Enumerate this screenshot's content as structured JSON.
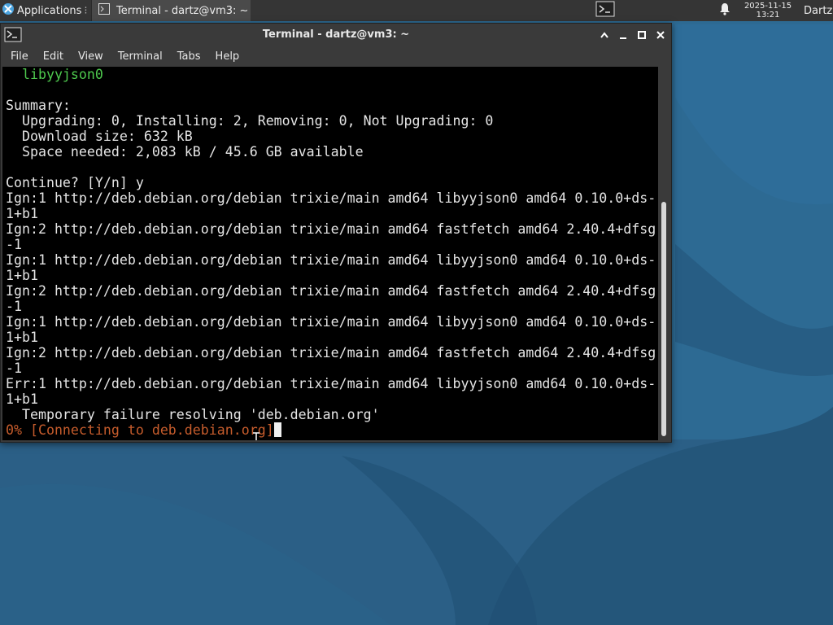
{
  "panel": {
    "applications_label": "Applications",
    "task_label": "Terminal - dartz@vm3: ~",
    "clock_date": "2025-11-15",
    "clock_time": "13:21",
    "user": "Dartz"
  },
  "window": {
    "title": "Terminal - dartz@vm3: ~",
    "menu": [
      "File",
      "Edit",
      "View",
      "Terminal",
      "Tabs",
      "Help"
    ]
  },
  "terminal": {
    "lines": [
      {
        "text": "  libyyjson0",
        "color": "green"
      },
      {
        "text": "",
        "color": ""
      },
      {
        "text": "Summary:",
        "color": ""
      },
      {
        "text": "  Upgrading: 0, Installing: 2, Removing: 0, Not Upgrading: 0",
        "color": ""
      },
      {
        "text": "  Download size: 632 kB",
        "color": ""
      },
      {
        "text": "  Space needed: 2,083 kB / 45.6 GB available",
        "color": ""
      },
      {
        "text": "",
        "color": ""
      },
      {
        "text": "Continue? [Y/n] y",
        "color": ""
      },
      {
        "text": "Ign:1 http://deb.debian.org/debian trixie/main amd64 libyyjson0 amd64 0.10.0+ds-",
        "color": ""
      },
      {
        "text": "1+b1",
        "color": ""
      },
      {
        "text": "Ign:2 http://deb.debian.org/debian trixie/main amd64 fastfetch amd64 2.40.4+dfsg",
        "color": ""
      },
      {
        "text": "-1",
        "color": ""
      },
      {
        "text": "Ign:1 http://deb.debian.org/debian trixie/main amd64 libyyjson0 amd64 0.10.0+ds-",
        "color": ""
      },
      {
        "text": "1+b1",
        "color": ""
      },
      {
        "text": "Ign:2 http://deb.debian.org/debian trixie/main amd64 fastfetch amd64 2.40.4+dfsg",
        "color": ""
      },
      {
        "text": "-1",
        "color": ""
      },
      {
        "text": "Ign:1 http://deb.debian.org/debian trixie/main amd64 libyyjson0 amd64 0.10.0+ds-",
        "color": ""
      },
      {
        "text": "1+b1",
        "color": ""
      },
      {
        "text": "Ign:2 http://deb.debian.org/debian trixie/main amd64 fastfetch amd64 2.40.4+dfsg",
        "color": ""
      },
      {
        "text": "-1",
        "color": ""
      },
      {
        "text": "Err:1 http://deb.debian.org/debian trixie/main amd64 libyyjson0 amd64 0.10.0+ds-",
        "color": ""
      },
      {
        "text": "1+b1",
        "color": ""
      },
      {
        "text": "  Temporary failure resolving 'deb.debian.org'",
        "color": ""
      }
    ],
    "prompt_line": "0% [Connecting to deb.debian.org]",
    "colors": {
      "green": "#4ec94e",
      "orange": "#c65c2c",
      "text": "#e5e5e5",
      "background": "#000000"
    }
  }
}
